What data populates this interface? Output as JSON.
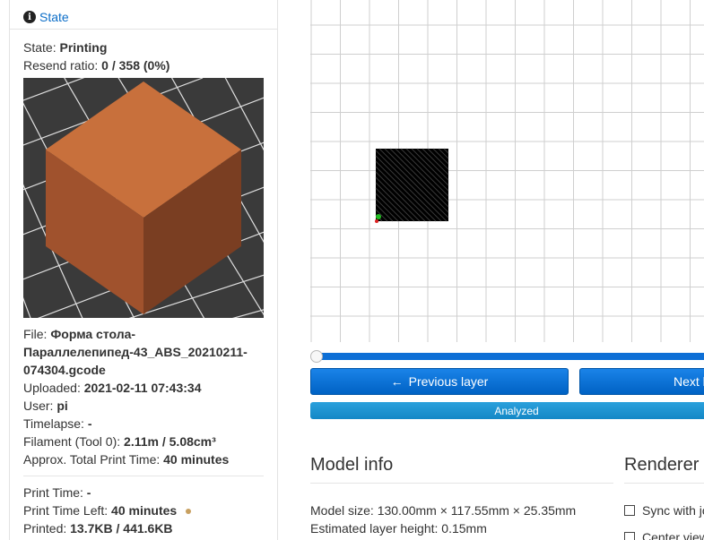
{
  "sidebar": {
    "header": "State",
    "state_label": "State:",
    "state_value": "Printing",
    "resend_label": "Resend ratio:",
    "resend_value": "0 / 358 (0%)",
    "file_label": "File:",
    "file_value_l1": "Форма стола-",
    "file_value_l2": "Параллелепипед-43_ABS_20210211-",
    "file_value_l3": "074304.gcode",
    "uploaded_label": "Uploaded:",
    "uploaded_value": "2021-02-11 07:43:34",
    "user_label": "User:",
    "user_value": "pi",
    "timelapse_label": "Timelapse:",
    "timelapse_value": "-",
    "filament_label": "Filament (Tool 0):",
    "filament_value": "2.11m / 5.08cm³",
    "approx_label": "Approx. Total Print Time:",
    "approx_value": "40 minutes",
    "print_time_label": "Print Time:",
    "print_time_value": "-",
    "time_left_label": "Print Time Left:",
    "time_left_value": "40 minutes",
    "printed_label": "Printed:",
    "printed_value": "13.7KB / 441.6KB"
  },
  "viewer": {
    "prev_label": "Previous layer",
    "next_label": "Next l",
    "analyzed_label": "Analyzed",
    "layer_progress": 0
  },
  "model_info": {
    "title": "Model info",
    "size_line": "Model size: 130.00mm × 117.55mm × 25.35mm",
    "layer_line": "Estimated layer height: 0.15mm"
  },
  "renderer": {
    "title": "Renderer",
    "sync_label": "Sync with jo",
    "center_label": "Center view"
  },
  "colors": {
    "accent": "#0c6ec8",
    "button": "#0062c4",
    "analyzed": "#1488c6",
    "cube_top": "#c8703c",
    "cube_left": "#a0522d",
    "cube_right": "#7a3e22"
  }
}
